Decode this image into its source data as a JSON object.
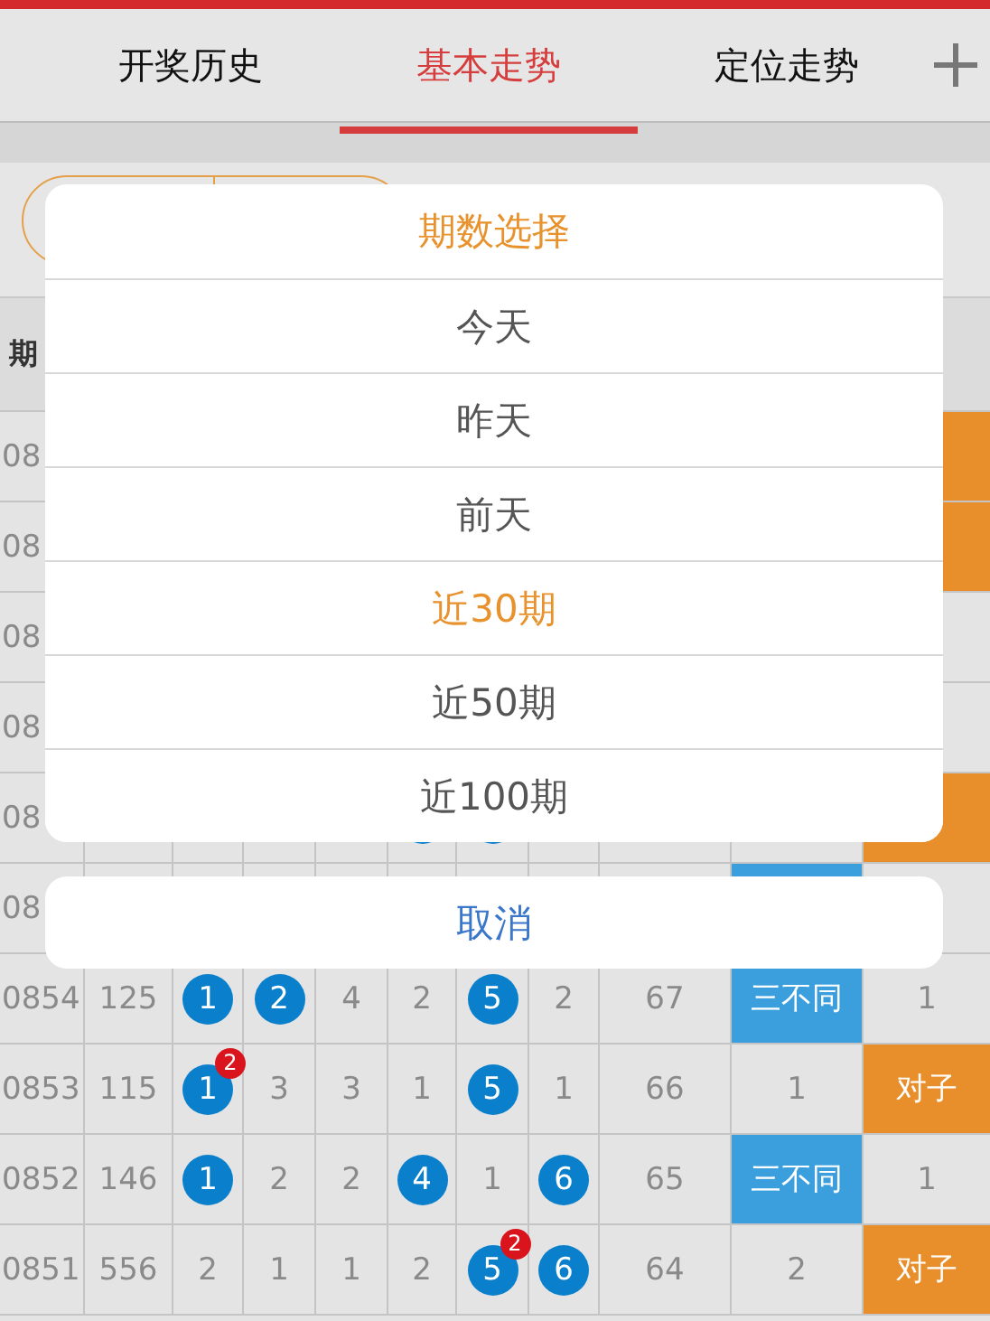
{
  "tabs": [
    {
      "label": "开奖历史",
      "selected": false
    },
    {
      "label": "基本走势",
      "selected": true
    },
    {
      "label": "定位走势",
      "selected": false
    }
  ],
  "table": {
    "column_1_header": "期",
    "rows": [
      {
        "cells": [
          {
            "kind": "plain",
            "text": "08"
          },
          {
            "kind": "orange"
          }
        ]
      },
      {
        "cells": [
          {
            "kind": "plain",
            "text": "08"
          },
          {
            "kind": "orange"
          }
        ]
      },
      {
        "cells": [
          {
            "kind": "plain",
            "text": "08"
          },
          {
            "kind": "plain"
          }
        ]
      },
      {
        "cells": [
          {
            "kind": "plain",
            "text": "08"
          },
          {
            "kind": "plain"
          }
        ]
      },
      {
        "cells": [
          {
            "kind": "plain",
            "text": "08"
          },
          {
            "kind": "plain"
          },
          {
            "kind": "plain"
          },
          {
            "kind": "plain"
          },
          {
            "kind": "plain"
          },
          {
            "kind": "ball"
          },
          {
            "kind": "ball"
          },
          {
            "kind": "plain"
          },
          {
            "kind": "plain"
          },
          {
            "kind": "plain"
          },
          {
            "kind": "orange"
          }
        ]
      },
      {
        "cells": [
          {
            "kind": "plain",
            "text": "08"
          },
          {
            "kind": "plain"
          },
          {
            "kind": "plain"
          },
          {
            "kind": "plain"
          },
          {
            "kind": "plain"
          },
          {
            "kind": "plain"
          },
          {
            "kind": "plain"
          },
          {
            "kind": "plain"
          },
          {
            "kind": "plain"
          },
          {
            "kind": "blue"
          },
          {
            "kind": "plain"
          }
        ]
      },
      {
        "cells": [
          {
            "kind": "plain",
            "text": "0854"
          },
          {
            "kind": "plain",
            "text": "125"
          },
          {
            "kind": "ball",
            "text": "1"
          },
          {
            "kind": "ball",
            "text": "2"
          },
          {
            "kind": "plain",
            "text": "4"
          },
          {
            "kind": "plain",
            "text": "2"
          },
          {
            "kind": "ball",
            "text": "5"
          },
          {
            "kind": "plain",
            "text": "2"
          },
          {
            "kind": "plain",
            "text": "67"
          },
          {
            "kind": "blue",
            "text": "三不同"
          },
          {
            "kind": "plain",
            "text": "1"
          }
        ]
      },
      {
        "cells": [
          {
            "kind": "plain",
            "text": "0853"
          },
          {
            "kind": "plain",
            "text": "115"
          },
          {
            "kind": "ball",
            "text": "1",
            "badge": "2"
          },
          {
            "kind": "plain",
            "text": "3"
          },
          {
            "kind": "plain",
            "text": "3"
          },
          {
            "kind": "plain",
            "text": "1"
          },
          {
            "kind": "ball",
            "text": "5"
          },
          {
            "kind": "plain",
            "text": "1"
          },
          {
            "kind": "plain",
            "text": "66"
          },
          {
            "kind": "plain",
            "text": "1"
          },
          {
            "kind": "orange",
            "text": "对子"
          }
        ]
      },
      {
        "cells": [
          {
            "kind": "plain",
            "text": "0852"
          },
          {
            "kind": "plain",
            "text": "146"
          },
          {
            "kind": "ball",
            "text": "1"
          },
          {
            "kind": "plain",
            "text": "2"
          },
          {
            "kind": "plain",
            "text": "2"
          },
          {
            "kind": "ball",
            "text": "4"
          },
          {
            "kind": "plain",
            "text": "1"
          },
          {
            "kind": "ball",
            "text": "6"
          },
          {
            "kind": "plain",
            "text": "65"
          },
          {
            "kind": "blue",
            "text": "三不同"
          },
          {
            "kind": "plain",
            "text": "1"
          }
        ]
      },
      {
        "cells": [
          {
            "kind": "plain",
            "text": "0851"
          },
          {
            "kind": "plain",
            "text": "556"
          },
          {
            "kind": "plain",
            "text": "2"
          },
          {
            "kind": "plain",
            "text": "1"
          },
          {
            "kind": "plain",
            "text": "1"
          },
          {
            "kind": "plain",
            "text": "2"
          },
          {
            "kind": "ball",
            "text": "5",
            "badge": "2"
          },
          {
            "kind": "ball",
            "text": "6"
          },
          {
            "kind": "plain",
            "text": "64"
          },
          {
            "kind": "plain",
            "text": "2"
          },
          {
            "kind": "orange",
            "text": "对子"
          }
        ]
      }
    ]
  },
  "sheet": {
    "title": "期数选择",
    "options": [
      {
        "label": "今天",
        "selected": false
      },
      {
        "label": "昨天",
        "selected": false
      },
      {
        "label": "前天",
        "selected": false
      },
      {
        "label": "近30期",
        "selected": true
      },
      {
        "label": "近50期",
        "selected": false
      },
      {
        "label": "近100期",
        "selected": false
      }
    ],
    "cancel": "取消"
  }
}
